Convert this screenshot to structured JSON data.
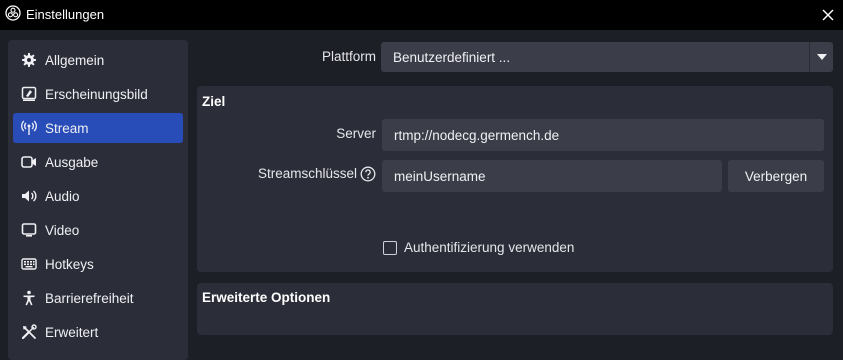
{
  "window": {
    "title": "Einstellungen",
    "app_icon": "obs-logo-icon",
    "close_icon": "close-icon"
  },
  "sidebar": {
    "items": [
      {
        "label": "Allgemein",
        "icon": "gear-icon",
        "active": false
      },
      {
        "label": "Erscheinungsbild",
        "icon": "appearance-icon",
        "active": false
      },
      {
        "label": "Stream",
        "icon": "broadcast-icon",
        "active": true
      },
      {
        "label": "Ausgabe",
        "icon": "output-icon",
        "active": false
      },
      {
        "label": "Audio",
        "icon": "speaker-icon",
        "active": false
      },
      {
        "label": "Video",
        "icon": "monitor-icon",
        "active": false
      },
      {
        "label": "Hotkeys",
        "icon": "keyboard-icon",
        "active": false
      },
      {
        "label": "Barrierefreiheit",
        "icon": "accessibility-icon",
        "active": false
      },
      {
        "label": "Erweitert",
        "icon": "tools-icon",
        "active": false
      }
    ]
  },
  "stream": {
    "platform_label": "Plattform",
    "platform_value": "Benutzerdefiniert ...",
    "destination_group": {
      "title": "Ziel",
      "server_label": "Server",
      "server_value": "rtmp://nodecg.germench.de",
      "key_label": "Streamschlüssel",
      "key_value": "meinUsername",
      "hide_button": "Verbergen",
      "auth_label": "Authentifizierung verwenden",
      "auth_checked": false
    },
    "advanced_group": {
      "title": "Erweiterte Optionen"
    }
  },
  "colors": {
    "accent": "#284cb8",
    "background": "#1d1f26",
    "panel": "#2b2e38",
    "field": "#3b3e48",
    "titlebar": "#000000"
  }
}
